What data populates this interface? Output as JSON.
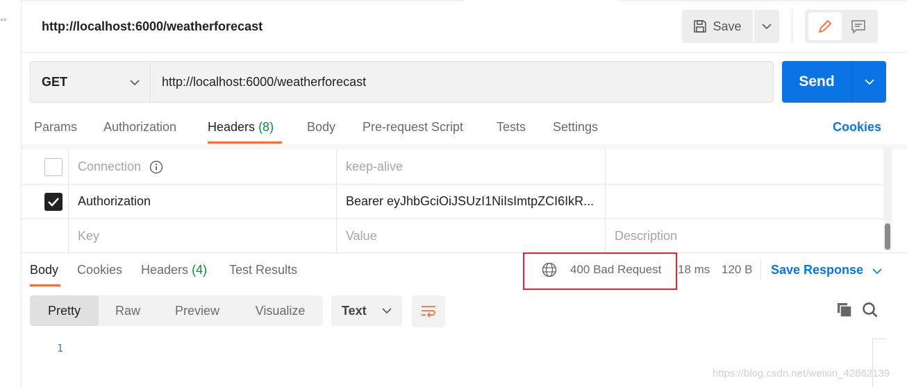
{
  "request": {
    "title": "http://localhost:6000/weatherforecast",
    "save_label": "Save",
    "method": "GET",
    "url": "http://localhost:6000/weatherforecast",
    "send_label": "Send"
  },
  "request_tabs": [
    {
      "label": "Params"
    },
    {
      "label": "Authorization"
    },
    {
      "label": "Headers",
      "count": "(8)"
    },
    {
      "label": "Body"
    },
    {
      "label": "Pre-request Script"
    },
    {
      "label": "Tests"
    },
    {
      "label": "Settings"
    }
  ],
  "cookies_link": "Cookies",
  "headers": [
    {
      "key": "Connection",
      "value": "keep-alive",
      "checked": false
    },
    {
      "key": "Authorization",
      "value": "Bearer eyJhbGciOiJSUzI1NiIsImtpZCI6IkR...",
      "checked": true
    }
  ],
  "placeholders": {
    "key": "Key",
    "value": "Value",
    "description": "Description"
  },
  "response_tabs": [
    {
      "label": "Body"
    },
    {
      "label": "Cookies"
    },
    {
      "label": "Headers",
      "count": "(4)"
    },
    {
      "label": "Test Results"
    }
  ],
  "status": {
    "code": "400 Bad Request",
    "time": "18 ms",
    "size": "120 B",
    "save_response": "Save Response"
  },
  "view_modes": [
    "Pretty",
    "Raw",
    "Preview",
    "Visualize"
  ],
  "format": "Text",
  "line_number": "1",
  "watermark": "https://blog.csdn.net/weixin_42862139"
}
